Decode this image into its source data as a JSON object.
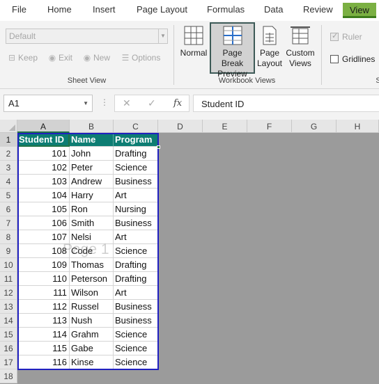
{
  "ribbon_tabs": [
    {
      "label": "File"
    },
    {
      "label": "Home"
    },
    {
      "label": "Insert"
    },
    {
      "label": "Page Layout"
    },
    {
      "label": "Formulas"
    },
    {
      "label": "Data"
    },
    {
      "label": "Review"
    },
    {
      "label": "View",
      "active": true
    }
  ],
  "sheet_view": {
    "dropdown_value": "Default",
    "keep_label": "Keep",
    "exit_label": "Exit",
    "new_label": "New",
    "options_label": "Options",
    "group_label": "Sheet View"
  },
  "workbook_views": {
    "normal_label": "Normal",
    "page_break_line1": "Page Break",
    "page_break_line2": "Preview",
    "page_layout_line1": "Page",
    "page_layout_line2": "Layout",
    "custom_line1": "Custom",
    "custom_line2": "Views",
    "group_label": "Workbook Views"
  },
  "show": {
    "ruler_label": "Ruler",
    "ruler_checked": true,
    "gridlines_label": "Gridlines",
    "gridlines_checked": false,
    "group_label_partial": "S"
  },
  "formula_bar": {
    "name_box": "A1",
    "cancel_icon": "✕",
    "enter_icon": "✓",
    "fx_label": "fx",
    "content": "Student ID"
  },
  "columns": [
    "A",
    "B",
    "C",
    "D",
    "E",
    "F",
    "G",
    "H"
  ],
  "rows": [
    "1",
    "2",
    "3",
    "4",
    "5",
    "6",
    "7",
    "8",
    "9",
    "10",
    "11",
    "12",
    "13",
    "14",
    "15",
    "16",
    "17",
    "18"
  ],
  "table": {
    "headers": [
      "Student ID",
      "Name",
      "Program"
    ],
    "rows": [
      [
        "101",
        "John",
        "Drafting"
      ],
      [
        "102",
        "Peter",
        "Science"
      ],
      [
        "103",
        "Andrew",
        "Business"
      ],
      [
        "104",
        "Harry",
        "Art"
      ],
      [
        "105",
        "Ron",
        "Nursing"
      ],
      [
        "106",
        "Smith",
        "Business"
      ],
      [
        "107",
        "Nelsi",
        "Art"
      ],
      [
        "108",
        "Code",
        "Science"
      ],
      [
        "109",
        "Thomas",
        "Drafting"
      ],
      [
        "110",
        "Peterson",
        "Drafting"
      ],
      [
        "111",
        "Wilson",
        "Art"
      ],
      [
        "112",
        "Russel",
        "Business"
      ],
      [
        "113",
        "Nush",
        "Business"
      ],
      [
        "114",
        "Grahm",
        "Science"
      ],
      [
        "115",
        "Gabe",
        "Science"
      ],
      [
        "116",
        "Kinse",
        "Science"
      ]
    ]
  },
  "page_watermark": "Page 1",
  "colors": {
    "view_tab": "#7bb043",
    "header_fill": "#0d7d73",
    "page_break_border": "#2020c0",
    "outside_area": "#9b9b9b"
  }
}
